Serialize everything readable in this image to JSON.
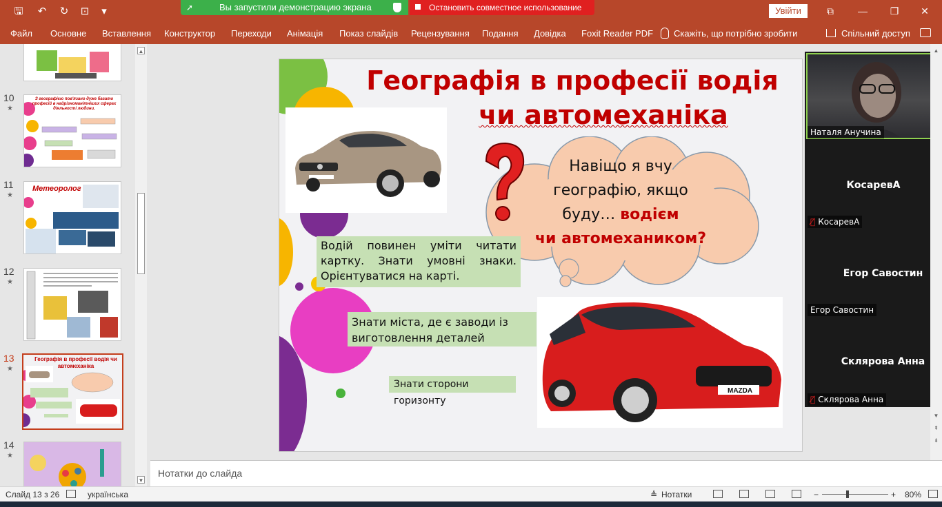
{
  "window": {
    "share_banner": "Вы запустили демонстрацию экрана",
    "stop_share": "Остановить совместное использование",
    "login_button": "Увійти"
  },
  "ribbon": {
    "tabs": [
      "Файл",
      "Основне",
      "Вставлення",
      "Конструктор",
      "Переходи",
      "Анімація",
      "Показ слайдів",
      "Рецензування",
      "Подання",
      "Довідка",
      "Foxit Reader PDF"
    ],
    "tell_me": "Скажіть, що потрібно зробити",
    "share": "Спільний доступ"
  },
  "thumbnails": [
    {
      "num": "10",
      "text": "З географією пов'язано дуже багато професій в найрізноманітніших сферах діяльності людини."
    },
    {
      "num": "11",
      "text": "Метеоролог"
    },
    {
      "num": "12",
      "text": ""
    },
    {
      "num": "13",
      "text": "Географія в професії водія чи автомеханіка"
    },
    {
      "num": "14",
      "text": ""
    }
  ],
  "slide": {
    "title_line1": "Географія в професії водія",
    "title_line2": "чи автомеханіка",
    "cloud_line1": "Навіщо я вчу",
    "cloud_line2": "географію, якщо",
    "cloud_line3": "буду… ",
    "cloud_red1": "водієм",
    "cloud_red2": "чи автомехаником?",
    "box1": "Водій повинен уміти читати картку. Знати умовні знаки. Орієнтуватися на карті.",
    "box2": "Знати міста, де є заводи із виготовлення деталей",
    "box3": "Знати сторони горизонту",
    "car2_brand": "MAZDA"
  },
  "participants": [
    {
      "name": "Наталя Анучина",
      "video": true
    },
    {
      "name": "КосаревА",
      "muted": true
    },
    {
      "name": "Егор Савостин",
      "muted": false
    },
    {
      "name": "Склярова Анна",
      "muted": true
    }
  ],
  "notes": {
    "placeholder": "Нотатки до слайда"
  },
  "status": {
    "slide_info": "Слайд 13 з 26",
    "language": "українська",
    "notes_button": "Нотатки",
    "zoom": "80%"
  },
  "colors": {
    "accent": "#b7472a",
    "title_red": "#c00000",
    "box_green": "#c6e0b4",
    "cloud_fill": "#f8cbad"
  }
}
